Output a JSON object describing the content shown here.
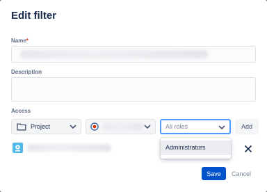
{
  "dialog": {
    "title": "Edit filter",
    "name_label": "Name",
    "name_required_mark": "*",
    "description_label": "Description",
    "access_label": "Access"
  },
  "access": {
    "scope_value": "Project",
    "roles_placeholder": "All roles",
    "add_label": "Add",
    "dropdown_options": [
      "Administrators"
    ]
  },
  "footer": {
    "save_label": "Save",
    "cancel_label": "Cancel"
  },
  "icons": {
    "folder": "folder-icon",
    "chevron": "chevron-down-icon",
    "project_avatar": "project-avatar-icon",
    "entry_avatar": "entry-avatar-icon",
    "remove": "close-icon"
  },
  "colors": {
    "primary": "#0052cc",
    "focus": "#4c9aff",
    "required": "#de350b"
  }
}
